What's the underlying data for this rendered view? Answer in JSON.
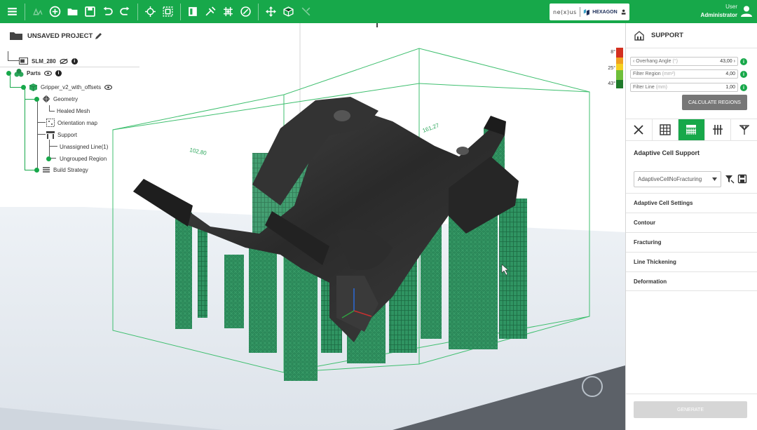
{
  "toolbar": {
    "left_icons": [
      "menu-icon",
      "tree-scene-icon",
      "add-part-icon",
      "open-folder-icon",
      "save-icon",
      "undo-icon",
      "redo-icon",
      "transform-icon",
      "scale-fit-icon",
      "box-view-icon",
      "repair-icon",
      "mesh-grid-icon",
      "measure-icon",
      "move-icon",
      "cube-plus-icon",
      "disabled-tool-icon"
    ],
    "brand_left": "ne(x)us",
    "brand_right": "HEXAGON",
    "user_label": "User",
    "user_name": "Administrator"
  },
  "project": {
    "title": "UNSAVED PROJECT",
    "machine": "SLM_280",
    "nodes": {
      "parts": "Parts",
      "part_name": "Gripper_v2_with_offsets",
      "geometry": "Geometry",
      "healed_mesh": "Healed Mesh",
      "orientation_map": "Orientation map",
      "support": "Support",
      "unassigned_line": "Unassigned Line(1)",
      "ungrouped_region": "Ungrouped Region",
      "build_strategy": "Build Strategy"
    }
  },
  "legend": {
    "labels": [
      "8°",
      "25°",
      "43°"
    ],
    "colors": [
      "#d32f1f",
      "#f0a020",
      "#1f7a2a"
    ]
  },
  "viewport": {
    "dimension_labels": [
      "102,80",
      "161,27"
    ],
    "support_color": "#2b8a5a",
    "part_color": "#2a2a2a",
    "floor_color": "#e8edf2"
  },
  "panel": {
    "title": "SUPPORT",
    "params": [
      {
        "label": "Overhang Angle",
        "unit": "(°)",
        "value": "43,00"
      },
      {
        "label": "Filter Region",
        "unit": "(mm²)",
        "value": "4,00"
      },
      {
        "label": "Filter Line",
        "unit": "(mm)",
        "value": "1,00"
      }
    ],
    "calculate_label": "CALCULATE REGIONS",
    "tabs": [
      "no-support-icon",
      "block-support-icon",
      "adaptive-cell-icon",
      "line-support-icon",
      "tree-support-icon"
    ],
    "active_tab": 2,
    "section_title": "Adaptive Cell Support",
    "preset_value": "AdaptiveCellNoFracturing",
    "settings": [
      "Adaptive Cell Settings",
      "Contour",
      "Fracturing",
      "Line Thickening",
      "Deformation"
    ],
    "generate_label": "GENERATE"
  },
  "colors": {
    "accent": "#17a84a"
  }
}
